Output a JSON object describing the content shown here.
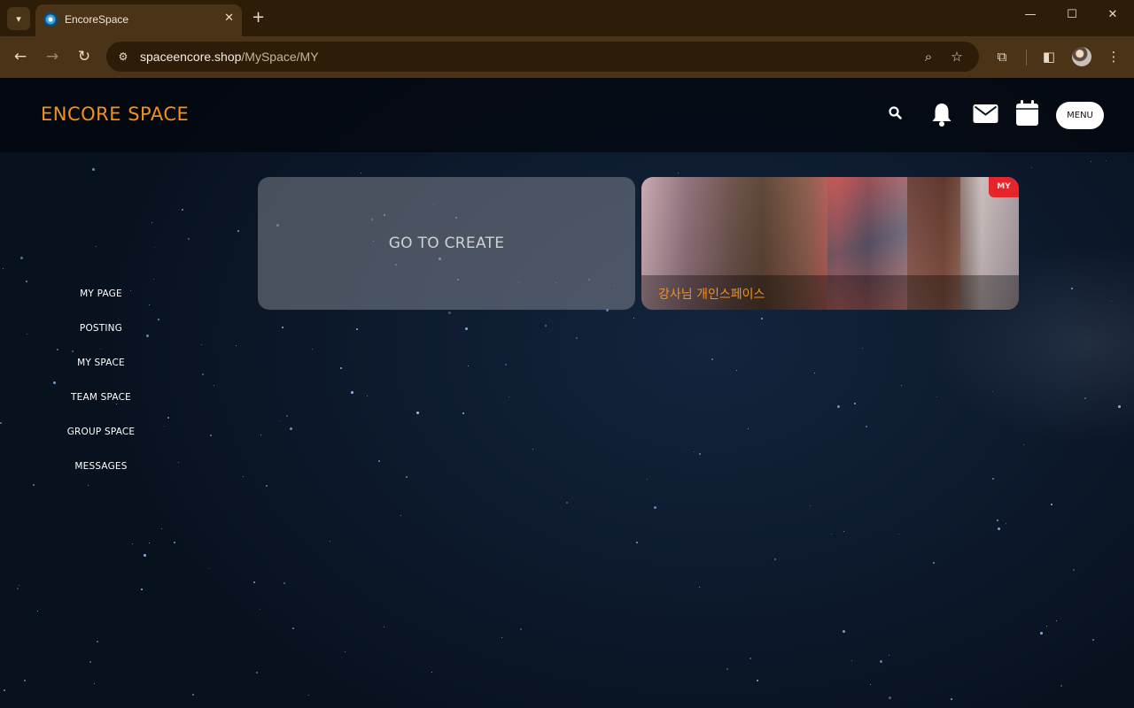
{
  "browser": {
    "tab_title": "EncoreSpace",
    "url_host": "spaceencore.shop",
    "url_path": "/MySpace/MY",
    "window_controls": {
      "minimize": "—",
      "maximize": "☐",
      "close": "✕"
    }
  },
  "header": {
    "logo": "ENCORE SPACE",
    "menu_label": "MENU",
    "icons": [
      "search-icon",
      "bell-icon",
      "mail-icon",
      "calendar-icon"
    ]
  },
  "sidenav": {
    "items": [
      "MY PAGE",
      "POSTING",
      "MY SPACE",
      "TEAM SPACE",
      "GROUP SPACE",
      "MESSAGES"
    ]
  },
  "cards": {
    "create_label": "GO TO CREATE",
    "space_title": "강사님 개인스페이스",
    "space_badge": "MY"
  },
  "colors": {
    "accent_orange": "#f0921e",
    "badge_red": "#e6252a",
    "chrome_brown": "#4a3316"
  }
}
